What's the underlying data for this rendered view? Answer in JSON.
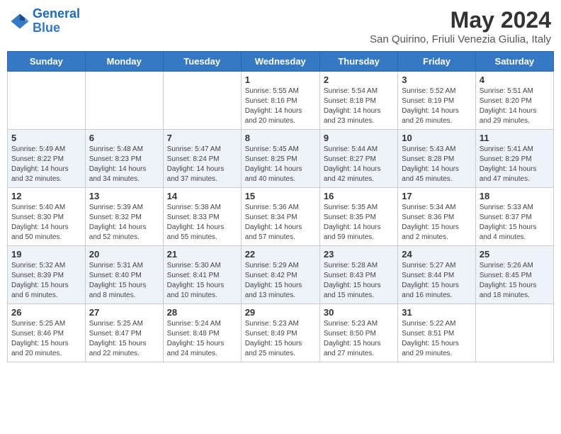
{
  "logo": {
    "line1": "General",
    "line2": "Blue"
  },
  "title": "May 2024",
  "subtitle": "San Quirino, Friuli Venezia Giulia, Italy",
  "weekdays": [
    "Sunday",
    "Monday",
    "Tuesday",
    "Wednesday",
    "Thursday",
    "Friday",
    "Saturday"
  ],
  "weeks": [
    [
      {
        "day": "",
        "info": ""
      },
      {
        "day": "",
        "info": ""
      },
      {
        "day": "",
        "info": ""
      },
      {
        "day": "1",
        "info": "Sunrise: 5:55 AM\nSunset: 8:16 PM\nDaylight: 14 hours\nand 20 minutes."
      },
      {
        "day": "2",
        "info": "Sunrise: 5:54 AM\nSunset: 8:18 PM\nDaylight: 14 hours\nand 23 minutes."
      },
      {
        "day": "3",
        "info": "Sunrise: 5:52 AM\nSunset: 8:19 PM\nDaylight: 14 hours\nand 26 minutes."
      },
      {
        "day": "4",
        "info": "Sunrise: 5:51 AM\nSunset: 8:20 PM\nDaylight: 14 hours\nand 29 minutes."
      }
    ],
    [
      {
        "day": "5",
        "info": "Sunrise: 5:49 AM\nSunset: 8:22 PM\nDaylight: 14 hours\nand 32 minutes."
      },
      {
        "day": "6",
        "info": "Sunrise: 5:48 AM\nSunset: 8:23 PM\nDaylight: 14 hours\nand 34 minutes."
      },
      {
        "day": "7",
        "info": "Sunrise: 5:47 AM\nSunset: 8:24 PM\nDaylight: 14 hours\nand 37 minutes."
      },
      {
        "day": "8",
        "info": "Sunrise: 5:45 AM\nSunset: 8:25 PM\nDaylight: 14 hours\nand 40 minutes."
      },
      {
        "day": "9",
        "info": "Sunrise: 5:44 AM\nSunset: 8:27 PM\nDaylight: 14 hours\nand 42 minutes."
      },
      {
        "day": "10",
        "info": "Sunrise: 5:43 AM\nSunset: 8:28 PM\nDaylight: 14 hours\nand 45 minutes."
      },
      {
        "day": "11",
        "info": "Sunrise: 5:41 AM\nSunset: 8:29 PM\nDaylight: 14 hours\nand 47 minutes."
      }
    ],
    [
      {
        "day": "12",
        "info": "Sunrise: 5:40 AM\nSunset: 8:30 PM\nDaylight: 14 hours\nand 50 minutes."
      },
      {
        "day": "13",
        "info": "Sunrise: 5:39 AM\nSunset: 8:32 PM\nDaylight: 14 hours\nand 52 minutes."
      },
      {
        "day": "14",
        "info": "Sunrise: 5:38 AM\nSunset: 8:33 PM\nDaylight: 14 hours\nand 55 minutes."
      },
      {
        "day": "15",
        "info": "Sunrise: 5:36 AM\nSunset: 8:34 PM\nDaylight: 14 hours\nand 57 minutes."
      },
      {
        "day": "16",
        "info": "Sunrise: 5:35 AM\nSunset: 8:35 PM\nDaylight: 14 hours\nand 59 minutes."
      },
      {
        "day": "17",
        "info": "Sunrise: 5:34 AM\nSunset: 8:36 PM\nDaylight: 15 hours\nand 2 minutes."
      },
      {
        "day": "18",
        "info": "Sunrise: 5:33 AM\nSunset: 8:37 PM\nDaylight: 15 hours\nand 4 minutes."
      }
    ],
    [
      {
        "day": "19",
        "info": "Sunrise: 5:32 AM\nSunset: 8:39 PM\nDaylight: 15 hours\nand 6 minutes."
      },
      {
        "day": "20",
        "info": "Sunrise: 5:31 AM\nSunset: 8:40 PM\nDaylight: 15 hours\nand 8 minutes."
      },
      {
        "day": "21",
        "info": "Sunrise: 5:30 AM\nSunset: 8:41 PM\nDaylight: 15 hours\nand 10 minutes."
      },
      {
        "day": "22",
        "info": "Sunrise: 5:29 AM\nSunset: 8:42 PM\nDaylight: 15 hours\nand 13 minutes."
      },
      {
        "day": "23",
        "info": "Sunrise: 5:28 AM\nSunset: 8:43 PM\nDaylight: 15 hours\nand 15 minutes."
      },
      {
        "day": "24",
        "info": "Sunrise: 5:27 AM\nSunset: 8:44 PM\nDaylight: 15 hours\nand 16 minutes."
      },
      {
        "day": "25",
        "info": "Sunrise: 5:26 AM\nSunset: 8:45 PM\nDaylight: 15 hours\nand 18 minutes."
      }
    ],
    [
      {
        "day": "26",
        "info": "Sunrise: 5:25 AM\nSunset: 8:46 PM\nDaylight: 15 hours\nand 20 minutes."
      },
      {
        "day": "27",
        "info": "Sunrise: 5:25 AM\nSunset: 8:47 PM\nDaylight: 15 hours\nand 22 minutes."
      },
      {
        "day": "28",
        "info": "Sunrise: 5:24 AM\nSunset: 8:48 PM\nDaylight: 15 hours\nand 24 minutes."
      },
      {
        "day": "29",
        "info": "Sunrise: 5:23 AM\nSunset: 8:49 PM\nDaylight: 15 hours\nand 25 minutes."
      },
      {
        "day": "30",
        "info": "Sunrise: 5:23 AM\nSunset: 8:50 PM\nDaylight: 15 hours\nand 27 minutes."
      },
      {
        "day": "31",
        "info": "Sunrise: 5:22 AM\nSunset: 8:51 PM\nDaylight: 15 hours\nand 29 minutes."
      },
      {
        "day": "",
        "info": ""
      }
    ]
  ]
}
